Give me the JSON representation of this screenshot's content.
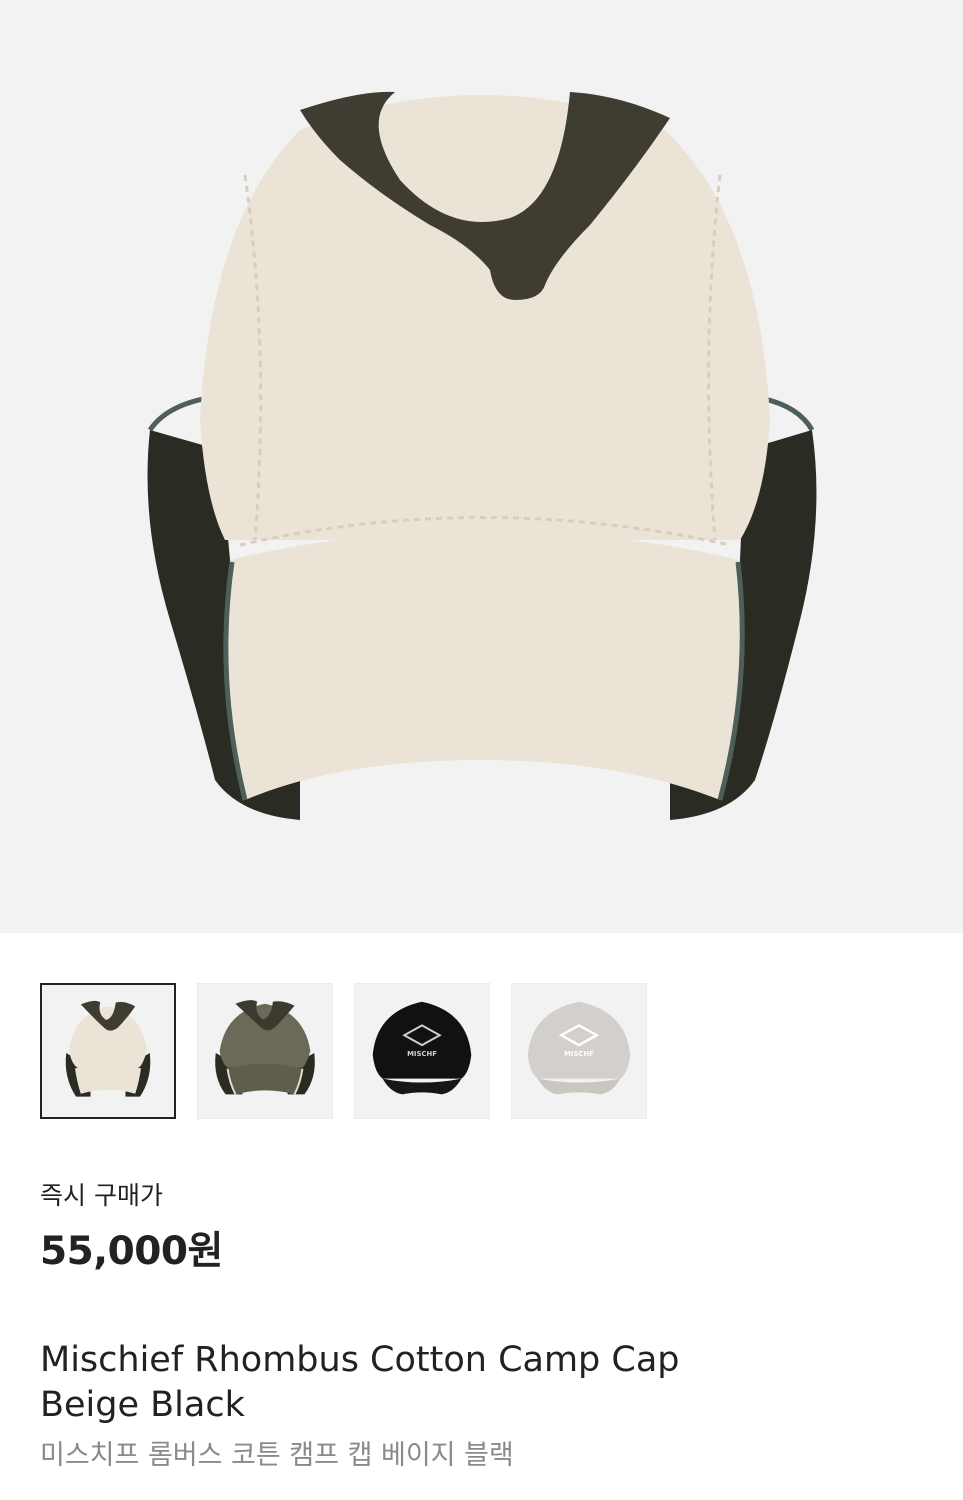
{
  "product": {
    "main_image": "beige-black-camp-cap-photo",
    "thumbnails": [
      {
        "name": "beige-black-cap",
        "selected": true
      },
      {
        "name": "khaki-cap",
        "selected": false
      },
      {
        "name": "black-logo-cap",
        "selected": false
      },
      {
        "name": "light-gray-logo-cap",
        "selected": false
      }
    ],
    "thumb_logo_text": "MISCHF",
    "price_label": "즉시 구매가",
    "price": "55,000원",
    "title_en_line1": "Mischief Rhombus Cotton Camp Cap",
    "title_en_line2": "Beige Black",
    "title_ko": "미스치프 롬버스 코튼 캠프 캡 베이지 블랙"
  },
  "colors": {
    "hero_bg": "#f2f2f2",
    "cap_beige": "#ebe3d5",
    "cap_dark": "#2a2b22",
    "print_dark": "#3f3d31",
    "piping": "#4e5f5a",
    "price_text": "#222222",
    "subtitle_text": "#8a8a8a"
  }
}
